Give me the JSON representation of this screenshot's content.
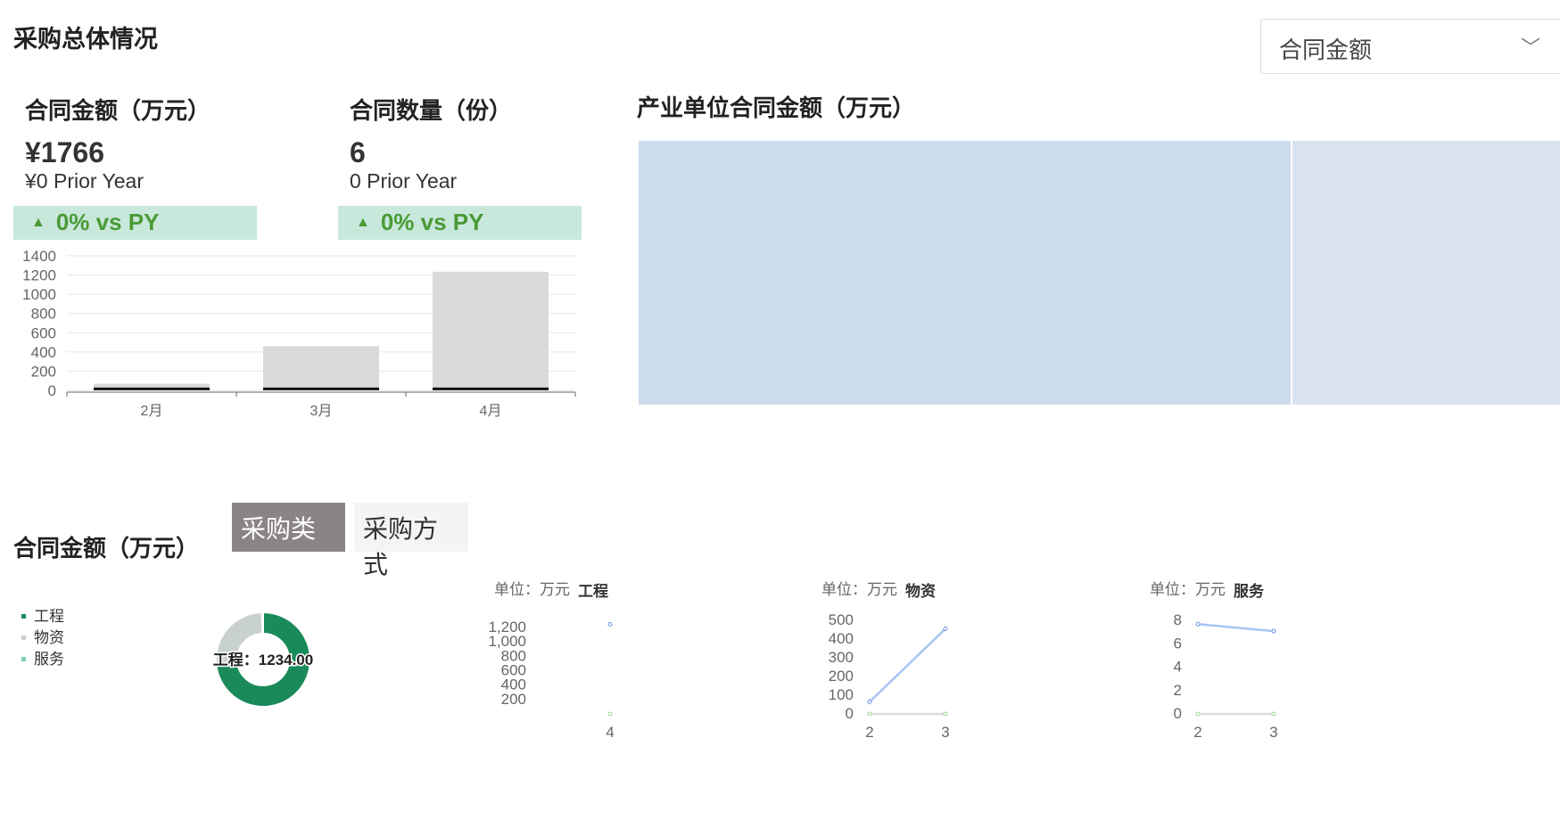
{
  "header": {
    "title": "采购总体情况",
    "dropdown_value": "合同金额"
  },
  "kpis": [
    {
      "title": "合同金额（万元）",
      "value": "¥1766",
      "prior": "¥0 Prior Year",
      "delta": "0% vs PY"
    },
    {
      "title": "合同数量（份）",
      "value": "6",
      "prior": "0 Prior Year",
      "delta": "0% vs PY"
    }
  ],
  "treemap": {
    "title": "产业单位合同金额（万元）"
  },
  "bottom": {
    "title": "合同金额（万元）",
    "tabs": [
      "采购类型",
      "采购方式"
    ],
    "active_tab": 0
  },
  "colors": {
    "accent_green": "#1a8a5a",
    "badge_bg": "#c8e8dc",
    "badge_text": "#4a9a34"
  },
  "chart_data": [
    {
      "type": "bar",
      "categories": [
        "2月",
        "3月",
        "4月"
      ],
      "series": [
        {
          "values": [
            70,
            460,
            1234
          ]
        },
        {
          "values": [
            20,
            20,
            20
          ]
        }
      ],
      "yticks": [
        0,
        200,
        400,
        600,
        800,
        1000,
        1200,
        1400
      ],
      "ylim": [
        0,
        1400
      ],
      "grid": true
    },
    {
      "type": "pie",
      "legend": [
        "工程",
        "物资",
        "服务"
      ],
      "values": [
        1234,
        450,
        7
      ],
      "colors": [
        "#1a8a5a",
        "#c9d1cd",
        "#7fd3b0"
      ],
      "label": "工程：1234.00"
    },
    {
      "type": "line",
      "unit": "单位：万元",
      "title": "工程",
      "x": [
        "4"
      ],
      "series": [
        {
          "values": [
            1234
          ]
        },
        {
          "values": [
            0
          ]
        }
      ],
      "yticks": [
        "200",
        "400",
        "600",
        "800",
        "1,000",
        "1,200"
      ],
      "ylim": [
        0,
        1300
      ]
    },
    {
      "type": "line",
      "unit": "单位：万元",
      "title": "物资",
      "x": [
        "2",
        "3"
      ],
      "series": [
        {
          "values": [
            60,
            450
          ]
        },
        {
          "values": [
            0,
            0
          ]
        }
      ],
      "yticks": [
        "0",
        "100",
        "200",
        "300",
        "400",
        "500"
      ],
      "ylim": [
        0,
        500
      ]
    },
    {
      "type": "line",
      "unit": "单位：万元",
      "title": "服务",
      "x": [
        "2",
        "3"
      ],
      "series": [
        {
          "values": [
            7.6,
            7
          ]
        },
        {
          "values": [
            0,
            0
          ]
        }
      ],
      "yticks": [
        "0",
        "2",
        "4",
        "6",
        "8"
      ],
      "ylim": [
        0,
        8
      ]
    }
  ]
}
